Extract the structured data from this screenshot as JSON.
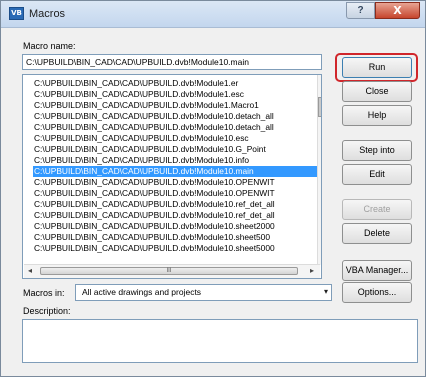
{
  "window": {
    "title": "Macros",
    "app_icon_text": "VB",
    "help_button": "?",
    "close_button": "X"
  },
  "macro_name": {
    "label": "Macro name:",
    "value": "C:\\UPBUILD\\BIN_CAD\\CAD\\UPBUILD.dvb!Module10.main"
  },
  "macro_list": {
    "items": [
      "C:\\UPBUILD\\BIN_CAD\\CAD\\UPBUILD.dvb!Module1.er",
      "C:\\UPBUILD\\BIN_CAD\\CAD\\UPBUILD.dvb!Module1.esc",
      "C:\\UPBUILD\\BIN_CAD\\CAD\\UPBUILD.dvb!Module1.Macro1",
      "C:\\UPBUILD\\BIN_CAD\\CAD\\UPBUILD.dvb!Module10.detach_all",
      "C:\\UPBUILD\\BIN_CAD\\CAD\\UPBUILD.dvb!Module10.detach_all",
      "C:\\UPBUILD\\BIN_CAD\\CAD\\UPBUILD.dvb!Module10.esc",
      "C:\\UPBUILD\\BIN_CAD\\CAD\\UPBUILD.dvb!Module10.G_Point",
      "C:\\UPBUILD\\BIN_CAD\\CAD\\UPBUILD.dvb!Module10.info",
      "C:\\UPBUILD\\BIN_CAD\\CAD\\UPBUILD.dvb!Module10.main",
      "C:\\UPBUILD\\BIN_CAD\\CAD\\UPBUILD.dvb!Module10.OPENWIT",
      "C:\\UPBUILD\\BIN_CAD\\CAD\\UPBUILD.dvb!Module10.OPENWIT",
      "C:\\UPBUILD\\BIN_CAD\\CAD\\UPBUILD.dvb!Module10.ref_det_all",
      "C:\\UPBUILD\\BIN_CAD\\CAD\\UPBUILD.dvb!Module10.ref_det_all",
      "C:\\UPBUILD\\BIN_CAD\\CAD\\UPBUILD.dvb!Module10.sheet2000",
      "C:\\UPBUILD\\BIN_CAD\\CAD\\UPBUILD.dvb!Module10.sheet500",
      "C:\\UPBUILD\\BIN_CAD\\CAD\\UPBUILD.dvb!Module10.sheet5000"
    ],
    "selected_index": 8,
    "hscroll_grip": "III",
    "hscroll_left": "◂",
    "hscroll_right": "▸"
  },
  "buttons": {
    "run": "Run",
    "close": "Close",
    "help": "Help",
    "step_into": "Step into",
    "edit": "Edit",
    "create": "Create",
    "delete": "Delete",
    "vba_manager": "VBA Manager...",
    "options": "Options..."
  },
  "macros_in": {
    "label": "Macros in:",
    "value": "All active drawings and projects",
    "arrow": "▾"
  },
  "description": {
    "label": "Description:"
  },
  "colors": {
    "selection": "#3399ff",
    "highlight": "#d0262b",
    "close_button": "#c6452d"
  }
}
